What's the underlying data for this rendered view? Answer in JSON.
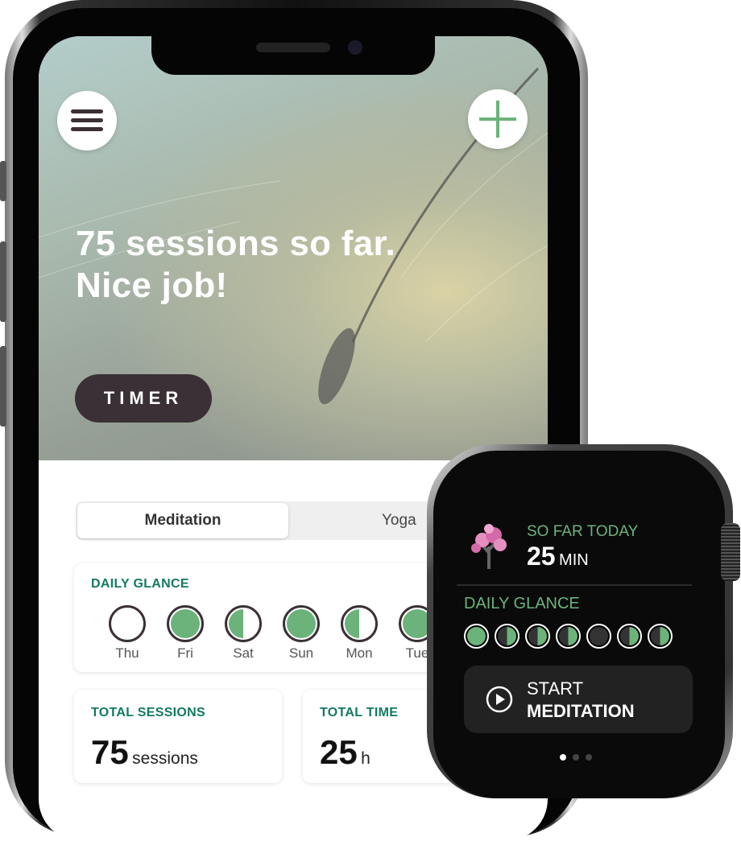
{
  "colors": {
    "accent_green": "#6bb37b",
    "label_green": "#127a62",
    "timer_bg": "#3a3035",
    "watch_label": "#6bb37b"
  },
  "phone": {
    "menu_icon": "hamburger-icon",
    "add_icon": "plus-icon",
    "headline_line1": "75 sessions so far.",
    "headline_line2": "Nice job!",
    "timer_label": "TIMER",
    "tabs": [
      {
        "label": "Meditation",
        "selected": true
      },
      {
        "label": "Yoga",
        "selected": false
      }
    ],
    "daily_glance": {
      "label": "DAILY GLANCE",
      "days": [
        {
          "name": "Thu",
          "fill": "none"
        },
        {
          "name": "Fri",
          "fill": "full"
        },
        {
          "name": "Sat",
          "fill": "half"
        },
        {
          "name": "Sun",
          "fill": "full"
        },
        {
          "name": "Mon",
          "fill": "half"
        },
        {
          "name": "Tue",
          "fill": "full"
        }
      ]
    },
    "total_sessions": {
      "label": "TOTAL SESSIONS",
      "value": "75",
      "unit": "sessions"
    },
    "total_time": {
      "label": "TOTAL TIME",
      "value": "25",
      "unit": "h"
    }
  },
  "watch": {
    "so_far_label": "SO FAR TODAY",
    "so_far_value": "25",
    "so_far_unit": "MIN",
    "daily_glance_label": "DAILY GLANCE",
    "days": [
      "full",
      "half",
      "half",
      "half",
      "none",
      "half",
      "half"
    ],
    "start_line1": "START",
    "start_line2": "MEDITATION",
    "page_count": 3,
    "current_page": 1
  }
}
